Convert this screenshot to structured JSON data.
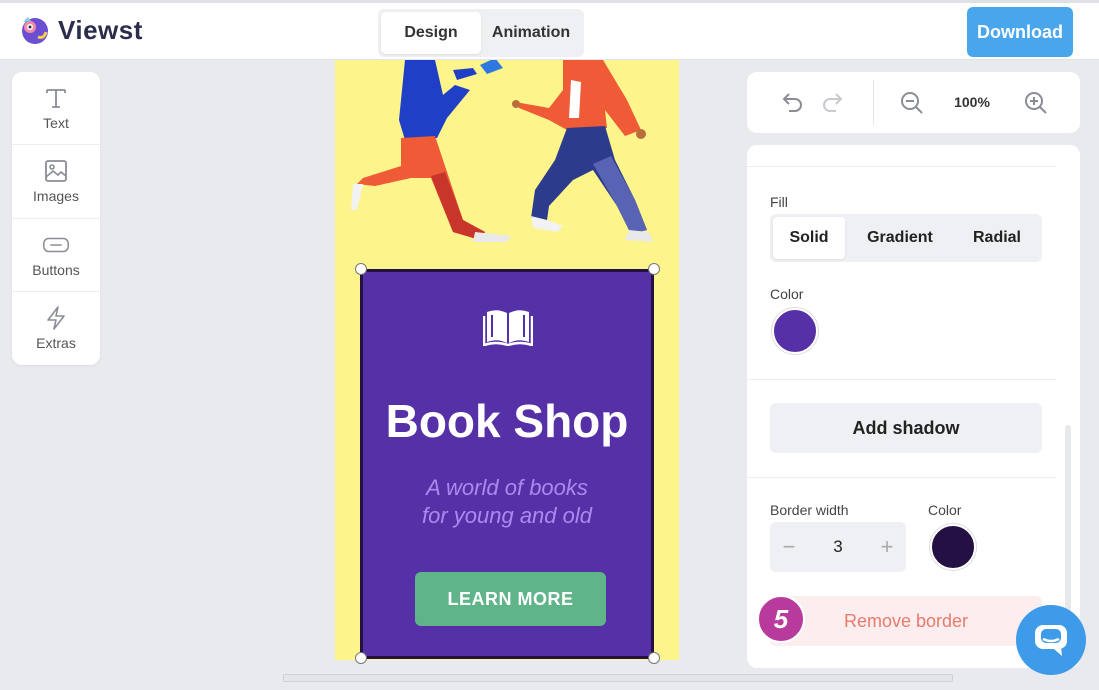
{
  "app": {
    "name": "Viewst"
  },
  "header": {
    "tabs": [
      {
        "label": "Design",
        "active": true
      },
      {
        "label": "Animation",
        "active": false
      }
    ],
    "download_label": "Download"
  },
  "tools": [
    {
      "label": "Text",
      "icon": "text-icon"
    },
    {
      "label": "Images",
      "icon": "image-icon"
    },
    {
      "label": "Buttons",
      "icon": "button-icon"
    },
    {
      "label": "Extras",
      "icon": "lightning-icon"
    }
  ],
  "canvas": {
    "card_title": "Book Shop",
    "card_subtitle_line1": "A world of books",
    "card_subtitle_line2": "for young and old",
    "cta_label": "LEARN MORE",
    "colors": {
      "background": "#fdf48b",
      "card": "#5530a6",
      "card_border": "#241042",
      "cta": "#5fb48a"
    }
  },
  "history": {
    "zoom": "100%"
  },
  "properties": {
    "fill_label": "Fill",
    "fill_tabs": [
      {
        "label": "Solid",
        "active": true
      },
      {
        "label": "Gradient",
        "active": false
      },
      {
        "label": "Radial",
        "active": false
      }
    ],
    "color_label": "Color",
    "fill_color": "#5530a6",
    "shadow_label": "Add shadow",
    "border_width_label": "Border width",
    "border_width_value": "3",
    "border_color_label": "Color",
    "border_color": "#241042",
    "remove_border_label": "Remove border"
  },
  "step_badge": "5"
}
